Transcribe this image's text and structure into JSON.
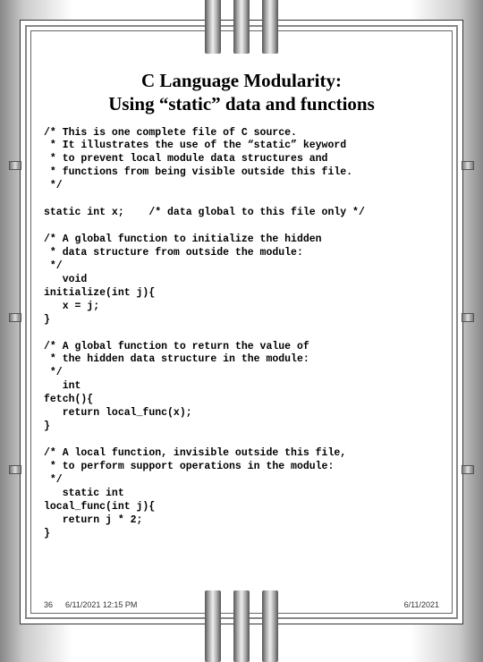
{
  "title": {
    "line1": "C Language Modularity:",
    "line2": "Using “static” data and functions"
  },
  "code": "/* This is one complete file of C source.\n * It illustrates the use of the “static” keyword\n * to prevent local module data structures and\n * functions from being visible outside this file.\n */\n\nstatic int x;    /* data global to this file only */\n\n/* A global function to initialize the hidden\n * data structure from outside the module:\n */\n   void\ninitialize(int j){\n   x = j;\n}\n\n/* A global function to return the value of\n * the hidden data structure in the module:\n */\n   int\nfetch(){\n   return local_func(x);\n}\n\n/* A local function, invisible outside this file,\n * to perform support operations in the module:\n */\n   static int\nlocal_func(int j){\n   return j * 2;\n}",
  "footer": {
    "page": "36",
    "datetime": "6/11/2021 12:15 PM",
    "date_r": "6/11/2021"
  }
}
